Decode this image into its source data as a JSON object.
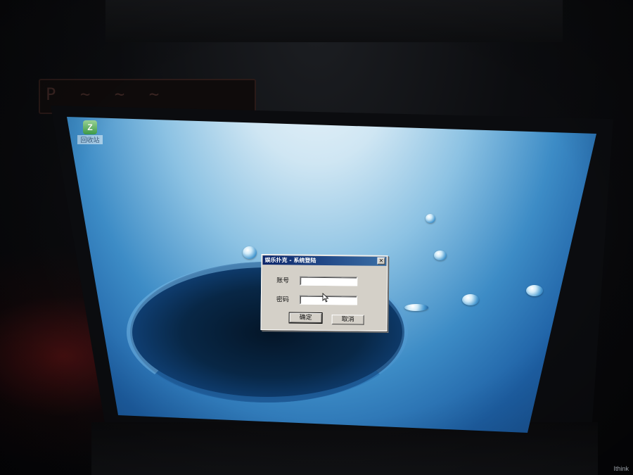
{
  "monitor": {
    "strip_text": "P ~ ~ ~"
  },
  "desktop": {
    "icon": {
      "glyph": "Z",
      "label": "回收站",
      "icon_name": "app-shortcut-icon"
    }
  },
  "dialog": {
    "title": "娱乐扑克 - 系统登陆",
    "close_label": "×",
    "fields": [
      {
        "label": "账号",
        "value": "",
        "placeholder": ""
      },
      {
        "label": "密码",
        "value": "",
        "placeholder": ""
      }
    ],
    "ok_label": "确定",
    "cancel_label": "取消"
  },
  "colors": {
    "titlebar_start": "#0a246a",
    "titlebar_end": "#3a6ea5",
    "dialog_face": "#d4d0c8",
    "wallpaper_deep": "#14488a",
    "wallpaper_light": "#eef6fb"
  },
  "watermark": "Ithink"
}
